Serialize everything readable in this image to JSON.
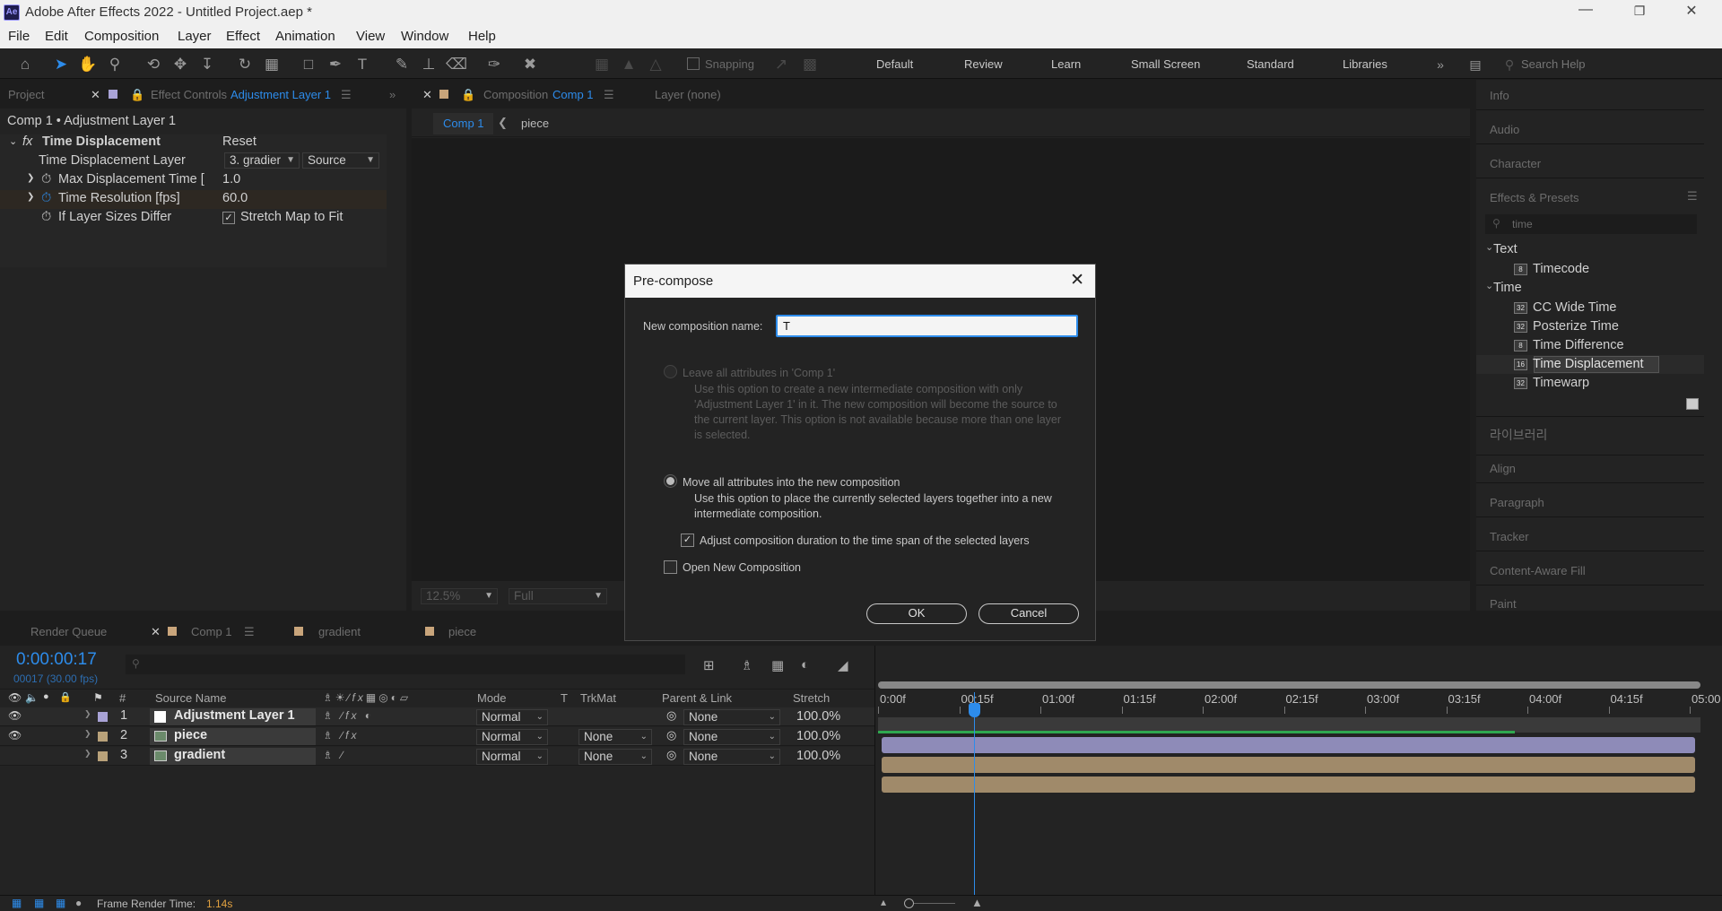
{
  "window": {
    "title": "Adobe After Effects 2022 - Untitled Project.aep *",
    "logo": "Ae",
    "controls": [
      "minimize-icon",
      "restore-icon",
      "close-icon"
    ]
  },
  "menu": [
    "File",
    "Edit",
    "Composition",
    "Layer",
    "Effect",
    "Animation",
    "View",
    "Window",
    "Help"
  ],
  "toolbar": {
    "snapping": "Snapping",
    "workspaces": [
      "Default",
      "Review",
      "Learn",
      "Small Screen",
      "Standard",
      "Libraries"
    ],
    "search_placeholder": "Search Help"
  },
  "left_panel": {
    "tabs": {
      "project": "Project",
      "effect_controls_prefix": "Effect Controls",
      "effect_controls_layer": "Adjustment Layer 1"
    },
    "breadcrumb": "Comp 1 • Adjustment Layer 1",
    "effect_name": "Time Displacement",
    "reset": "Reset",
    "rows": {
      "layer_label": "Time Displacement Layer",
      "layer_value": "3. gradier",
      "layer_source": "Source",
      "max_label": "Max Displacement Time [",
      "max_value": "1.0",
      "res_label": "Time Resolution [fps]",
      "res_value": "60.0",
      "differ_label": "If Layer Sizes Differ",
      "differ_check_label": "Stretch Map to Fit"
    }
  },
  "comp_panel": {
    "tab_prefix": "Composition",
    "tab_comp": "Comp 1",
    "layer_tab": "Layer (none)",
    "crumbs": [
      "Comp 1",
      "piece"
    ],
    "zoom": "12.5%",
    "resolution": "Full"
  },
  "right_panel": {
    "sections_top": [
      "Info",
      "Audio",
      "Character"
    ],
    "effects_title": "Effects & Presets",
    "search_value": "time",
    "groups": [
      {
        "name": "Text",
        "items": [
          {
            "label": "Timecode",
            "bits": "8"
          }
        ]
      },
      {
        "name": "Time",
        "items": [
          {
            "label": "CC Wide Time",
            "bits": "32"
          },
          {
            "label": "Posterize Time",
            "bits": "32"
          },
          {
            "label": "Time Difference",
            "bits": "8"
          },
          {
            "label": "Time Displacement",
            "bits": "16"
          },
          {
            "label": "Timewarp",
            "bits": "32"
          }
        ]
      }
    ],
    "korean_panel": "라이브러리",
    "sections_bottom": [
      "Align",
      "Paragraph",
      "Tracker",
      "Content-Aware Fill",
      "Paint"
    ]
  },
  "dialog": {
    "title": "Pre-compose",
    "name_label": "New composition name:",
    "name_value": "T",
    "option1_label": "Leave all attributes in 'Comp 1'",
    "option1_desc": "Use this option to create a new intermediate composition with only 'Adjustment Layer 1' in it. The new composition will become the source to the current layer. This option is not available because more than one layer is selected.",
    "option2_label": "Move all attributes into the new composition",
    "option2_desc": "Use this option to place the currently selected layers together into a new intermediate composition.",
    "adjust_label": "Adjust composition duration to the time span of the selected layers",
    "open_label": "Open New Composition",
    "ok": "OK",
    "cancel": "Cancel"
  },
  "timeline": {
    "tabs": [
      "Render Queue",
      "Comp 1",
      "gradient",
      "piece"
    ],
    "timecode": "0:00:00:17",
    "fps": "00017 (30.00 fps)",
    "columns": {
      "num": "#",
      "source": "Source Name",
      "mode": "Mode",
      "t": "T",
      "trkmat": "TrkMat",
      "parent": "Parent & Link",
      "stretch": "Stretch"
    },
    "ruler": [
      "0:00f",
      "00:15f",
      "01:00f",
      "01:15f",
      "02:00f",
      "02:15f",
      "03:00f",
      "03:15f",
      "04:00f",
      "04:15f",
      "05:00"
    ],
    "layers": [
      {
        "num": "1",
        "name": "Adjustment Layer 1",
        "mode": "Normal",
        "trkmat": "",
        "parent": "None",
        "stretch": "100.0%",
        "label_color": "#a9a3d6",
        "bar_color": "#8e8bb8"
      },
      {
        "num": "2",
        "name": "piece",
        "mode": "Normal",
        "trkmat": "None",
        "parent": "None",
        "stretch": "100.0%",
        "label_color": "#b9a27a",
        "bar_color": "#a08a6a"
      },
      {
        "num": "3",
        "name": "gradient",
        "mode": "Normal",
        "trkmat": "None",
        "parent": "None",
        "stretch": "100.0%",
        "label_color": "#b9a27a",
        "bar_color": "#a08a6a"
      }
    ],
    "status_label": "Frame Render Time:",
    "status_value": "1.14s"
  },
  "colors": {
    "accent": "#2d8ceb",
    "render_time": "#e0a040"
  }
}
